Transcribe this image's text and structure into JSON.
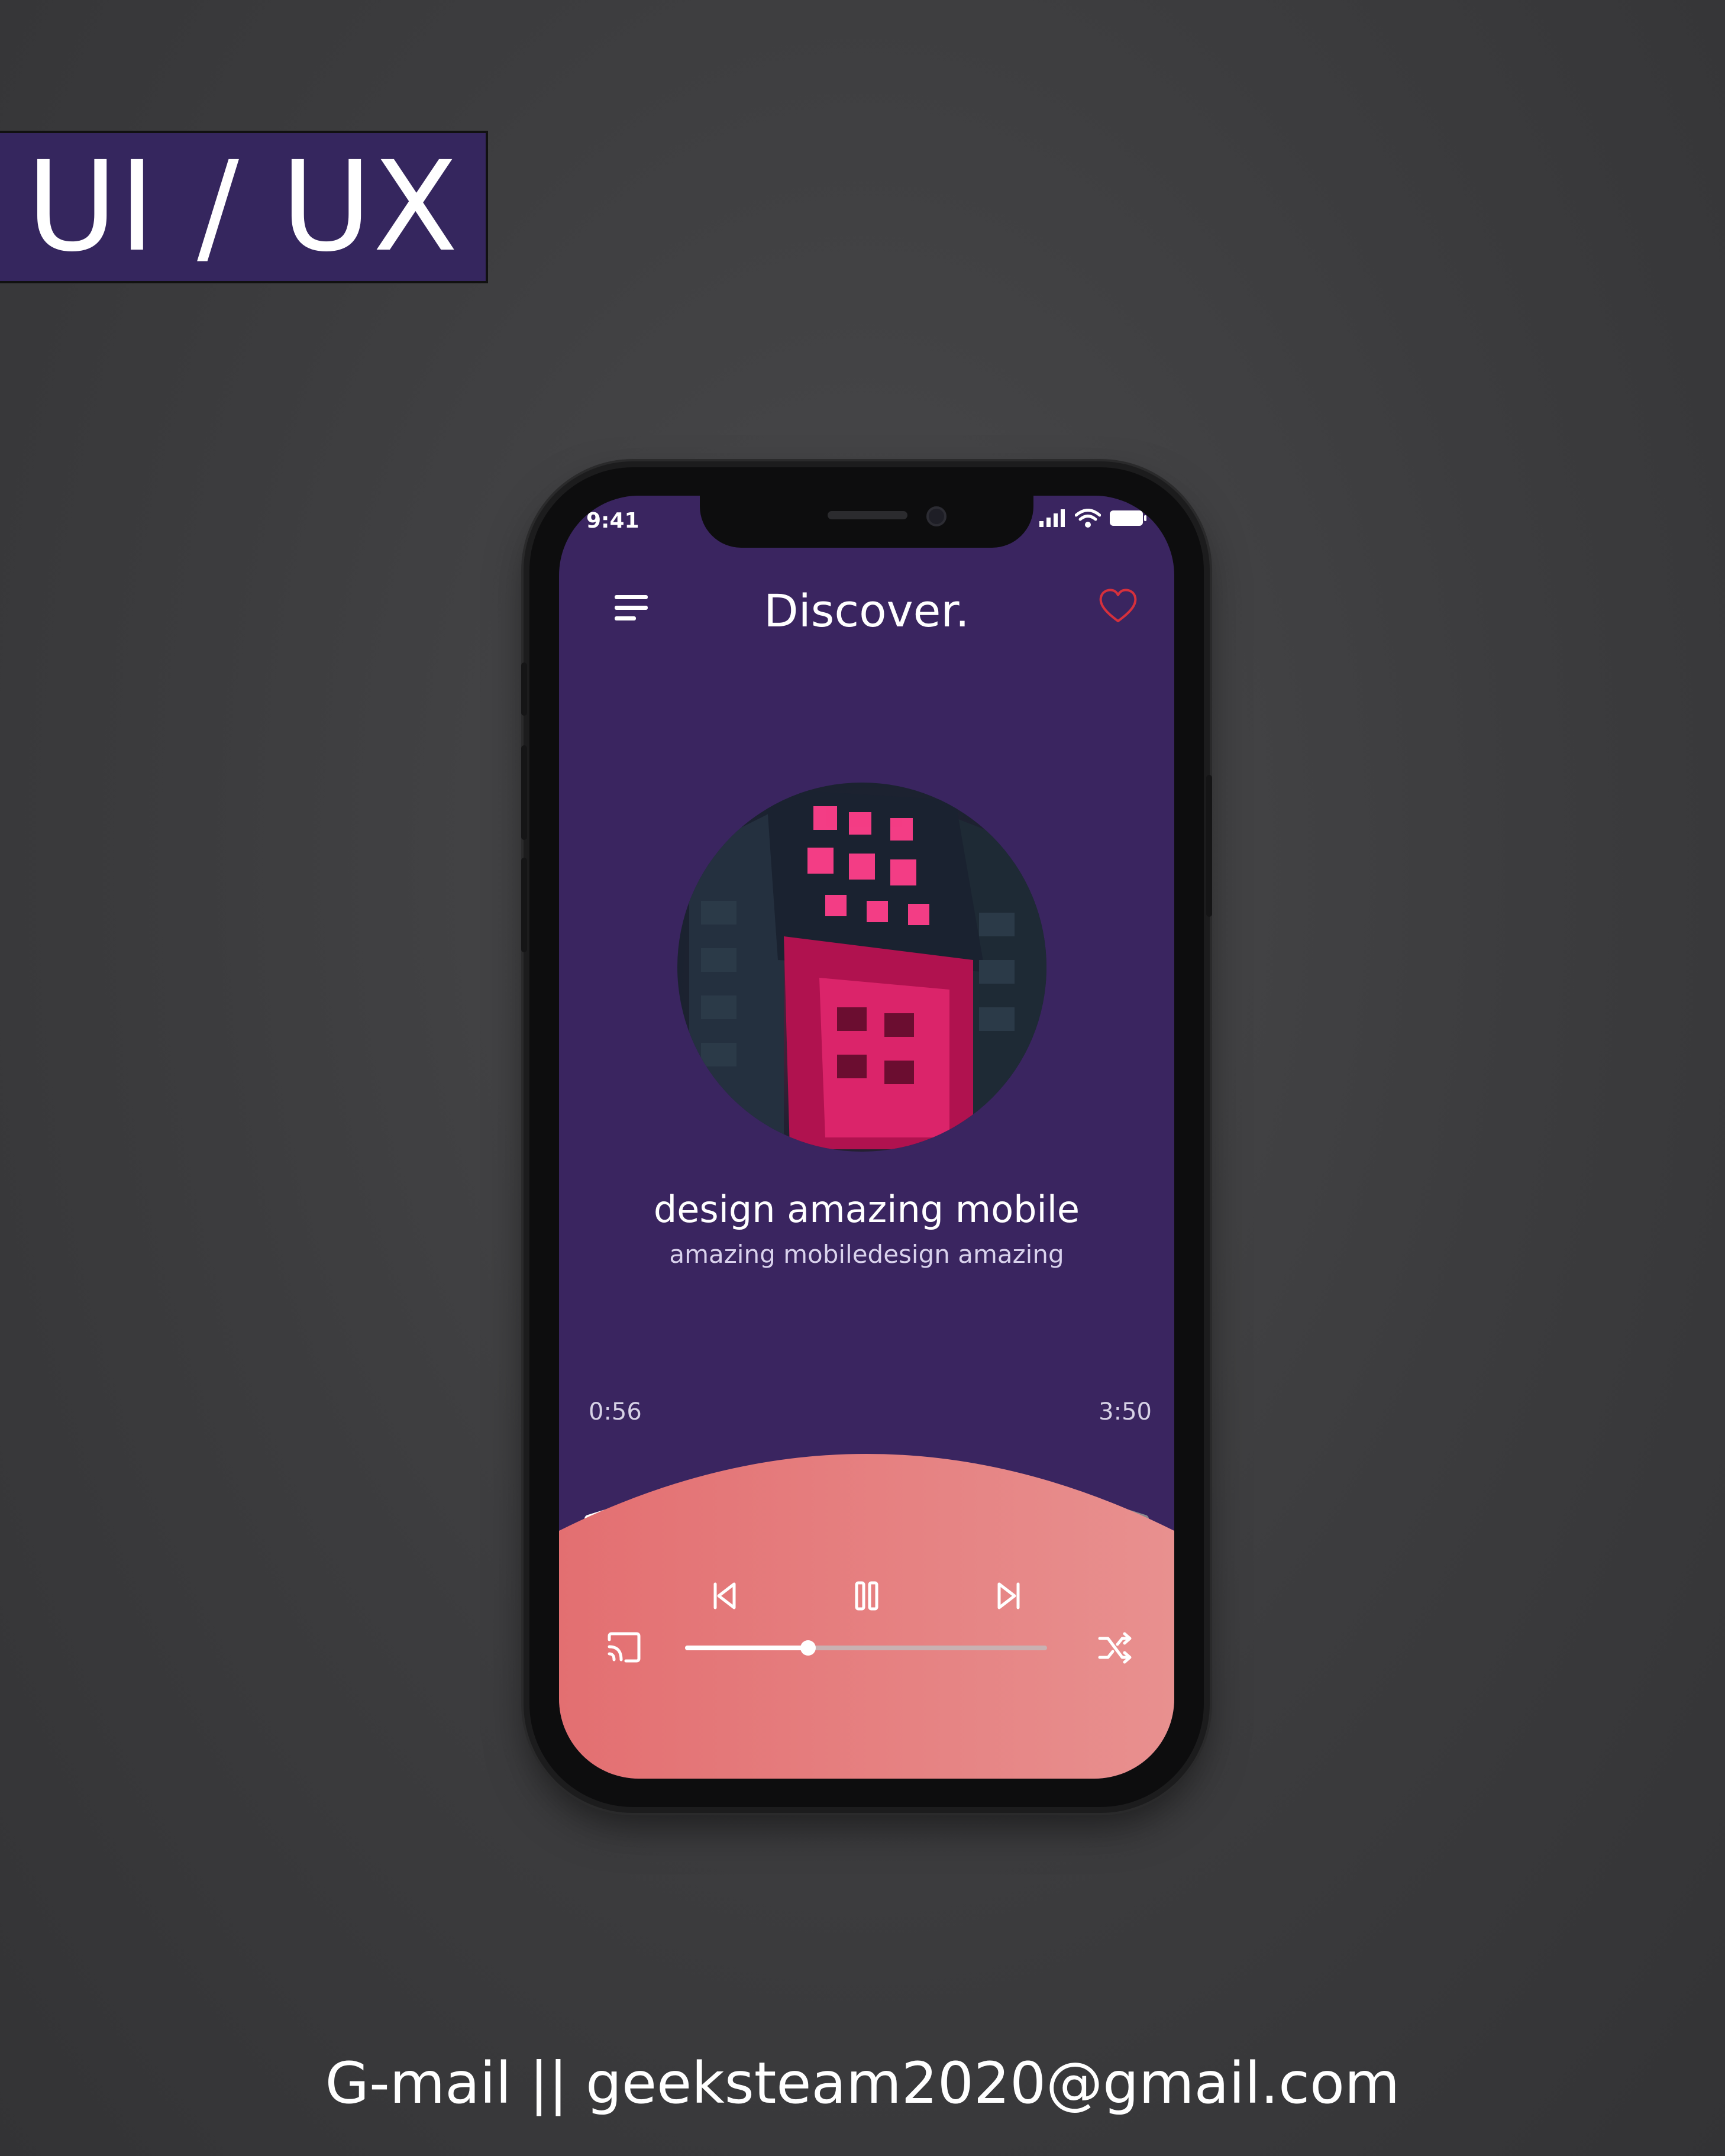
{
  "banner": {
    "text": "UI / UX"
  },
  "footer": {
    "contact": "G-mail || geeksteam2020@gmail.com"
  },
  "status_bar": {
    "time": "9:41",
    "icons": [
      "signal-icon",
      "wifi-icon",
      "battery-icon"
    ]
  },
  "header": {
    "title": "Discover.",
    "menu_icon": "menu-icon",
    "favorite_icon": "heart-icon"
  },
  "track": {
    "title": "design amazing mobile",
    "subtitle": "amazing mobiledesign amazing",
    "elapsed": "0:56",
    "duration": "3:50",
    "progress_fraction": 0.244
  },
  "controls": {
    "previous_icon": "skip-previous-icon",
    "pause_icon": "pause-icon",
    "next_icon": "skip-next-icon",
    "cast_icon": "cast-icon",
    "shuffle_icon": "shuffle-icon",
    "volume_fraction": 0.34
  },
  "colors": {
    "background": "#3c3c3e",
    "screen": "#3a2560",
    "badge": "#35265e",
    "panel_start": "#e36f71",
    "panel_end": "#e8908f",
    "heart": "#d6303c",
    "progress_track": "#8a8a8f"
  }
}
